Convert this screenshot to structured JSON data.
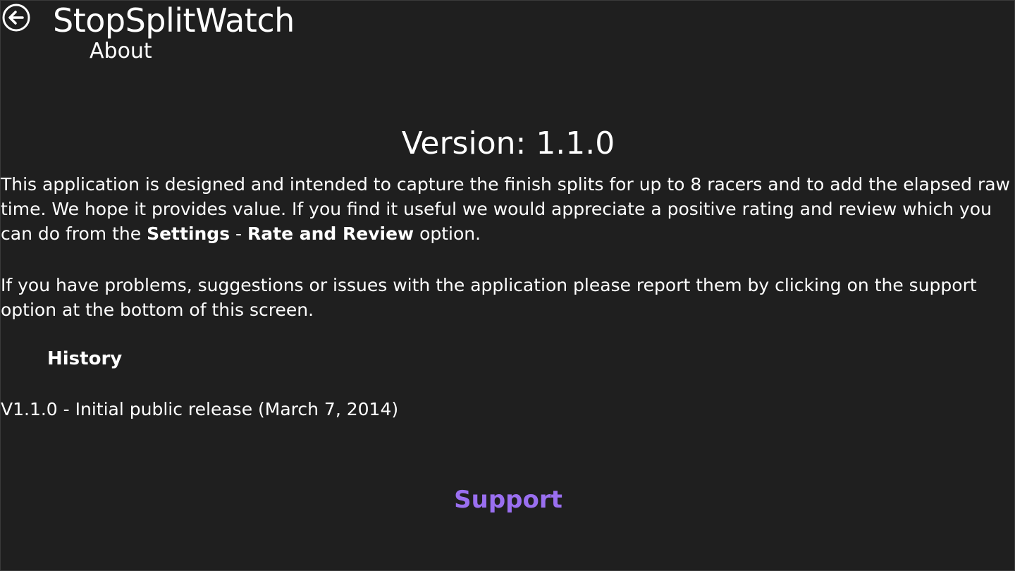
{
  "header": {
    "back_icon": "back-arrow-circle-icon",
    "app_title": "StopSplitWatch",
    "page_title": "About"
  },
  "main": {
    "version": "Version: 1.1.0",
    "intro": {
      "text_1": "This application is designed and intended to capture the finish splits for up to 8 racers and to add the elapsed raw time. We hope it provides value. If you find it useful we would appreciate a positive rating and review which you can do from the ",
      "settings_label": "Settings",
      "separator": " - ",
      "rate_review_label": "Rate and Review",
      "text_2": " option."
    },
    "problems_text": "If you have problems, suggestions or issues with the application please report them by clicking on the support option at the bottom of this screen.",
    "history": {
      "heading": "History",
      "items": [
        "V1.1.0 - Initial public release (March 7, 2014)"
      ]
    },
    "support_label": "Support"
  },
  "colors": {
    "background": "#1f1f1f",
    "text": "#ffffff",
    "accent": "#9a6ff0"
  }
}
